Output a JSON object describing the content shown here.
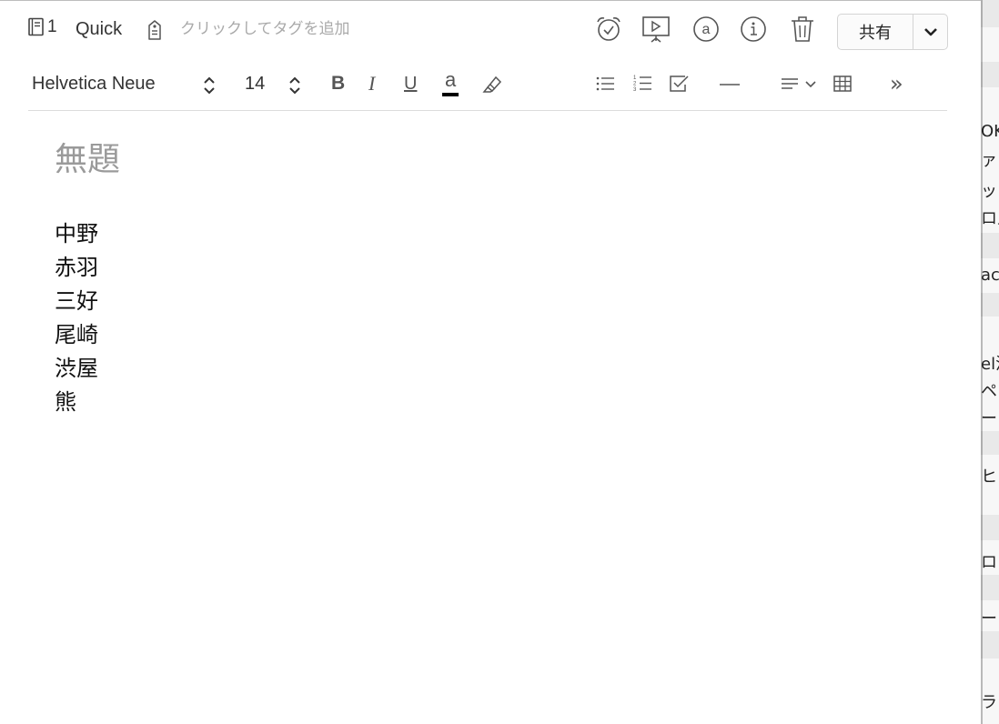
{
  "header": {
    "notebook_count": "1",
    "notebook_name": "Quick",
    "tag_placeholder": "クリックしてタグを追加",
    "share_label": "共有"
  },
  "toolbar": {
    "font_name": "Helvetica Neue",
    "font_size": "14",
    "bold": "B",
    "italic": "I",
    "underline": "U",
    "text_color_letter": "a",
    "more": "»"
  },
  "note": {
    "title": "無題",
    "lines": [
      "中野",
      "赤羽",
      "三好",
      "尾崎",
      "渋屋",
      "熊"
    ]
  },
  "background_window": {
    "fragments": [
      "OK",
      "ァ",
      "ット",
      "ロ入",
      "ac",
      "el活",
      "ペ",
      "ービ",
      "ヒ",
      "ロン",
      "ー",
      "ラ"
    ]
  },
  "icons": {
    "notebook": "notebook-icon",
    "tag": "tag-icon",
    "reminder": "alarm-clock-icon",
    "present": "presentation-icon",
    "mention": "at-sign-icon",
    "info": "info-icon",
    "delete": "trash-icon",
    "dropdown": "chevron-down-icon"
  },
  "colors": {
    "text_color_swatch": "#000000"
  }
}
